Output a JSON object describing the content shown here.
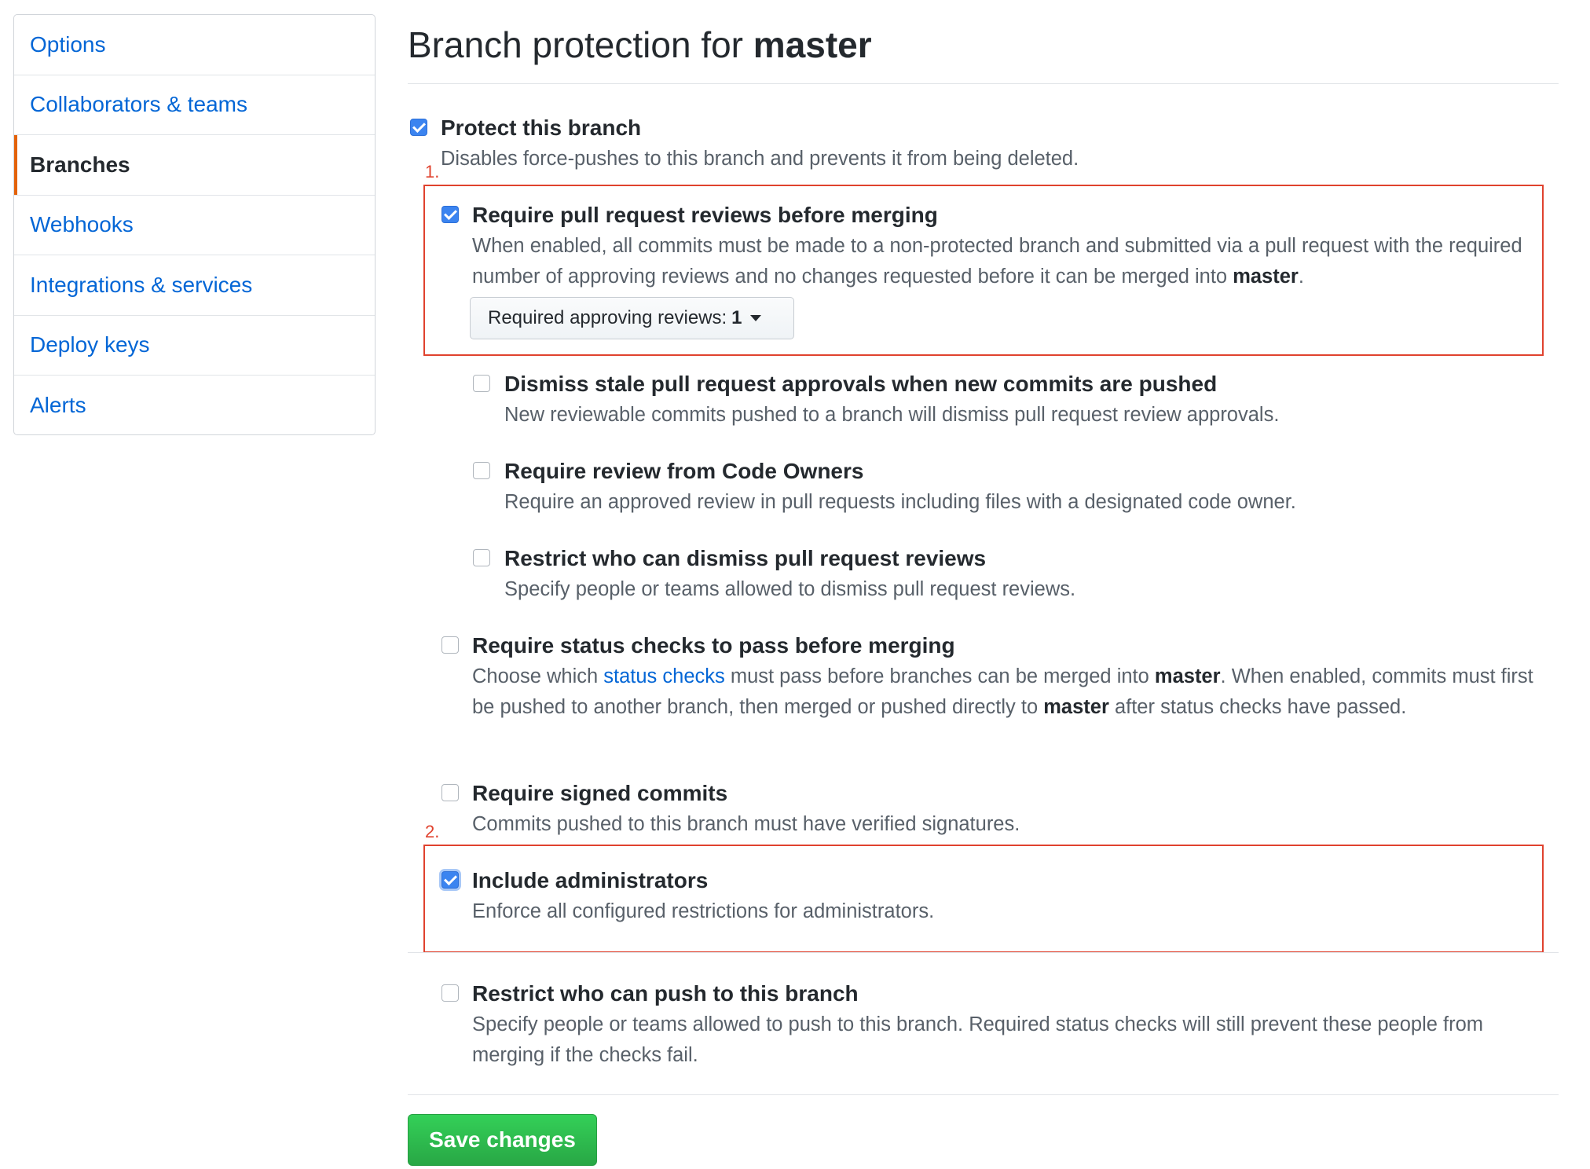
{
  "sidebar": {
    "items": [
      {
        "label": "Options"
      },
      {
        "label": "Collaborators & teams"
      },
      {
        "label": "Branches",
        "selected": true
      },
      {
        "label": "Webhooks"
      },
      {
        "label": "Integrations & services"
      },
      {
        "label": "Deploy keys"
      },
      {
        "label": "Alerts"
      }
    ]
  },
  "header": {
    "title_prefix": "Branch protection for ",
    "branch": "master"
  },
  "annotations": {
    "first": "1.",
    "second": "2."
  },
  "options": {
    "protect": {
      "checked": true,
      "title": "Protect this branch",
      "desc": "Disables force-pushes to this branch and prevents it from being deleted."
    },
    "require_reviews": {
      "checked": true,
      "title": "Require pull request reviews before merging",
      "desc_a": "When enabled, all commits must be made to a non-protected branch and submitted via a pull request with the required number of approving reviews and no changes requested before it can be merged into ",
      "desc_branch": "master",
      "desc_end": ".",
      "select_label": "Required approving reviews:",
      "select_value": "1"
    },
    "dismiss_stale": {
      "checked": false,
      "title": "Dismiss stale pull request approvals when new commits are pushed",
      "desc": "New reviewable commits pushed to a branch will dismiss pull request review approvals."
    },
    "code_owners": {
      "checked": false,
      "title": "Require review from Code Owners",
      "desc": "Require an approved review in pull requests including files with a designated code owner."
    },
    "restrict_dismiss": {
      "checked": false,
      "title": "Restrict who can dismiss pull request reviews",
      "desc": "Specify people or teams allowed to dismiss pull request reviews."
    },
    "status_checks": {
      "checked": false,
      "title": "Require status checks to pass before merging",
      "desc_a": "Choose which ",
      "desc_link": "status checks",
      "desc_b": " must pass before branches can be merged into ",
      "desc_branch1": "master",
      "desc_c": ". When enabled, commits must first be pushed to another branch, then merged or pushed directly to ",
      "desc_branch2": "master",
      "desc_d": " after status checks have passed."
    },
    "signed_commits": {
      "checked": false,
      "title": "Require signed commits",
      "desc": "Commits pushed to this branch must have verified signatures."
    },
    "include_admins": {
      "checked": true,
      "title": "Include administrators",
      "desc": "Enforce all configured restrictions for administrators."
    },
    "restrict_push": {
      "checked": false,
      "title": "Restrict who can push to this branch",
      "desc": "Specify people or teams allowed to push to this branch. Required status checks will still prevent these people from merging if the checks fail."
    }
  },
  "footer": {
    "save_label": "Save changes"
  },
  "colors": {
    "accent": "#0366d6",
    "annotation": "#e0422e",
    "save": "#28a745",
    "selected_bar": "#e36209"
  }
}
